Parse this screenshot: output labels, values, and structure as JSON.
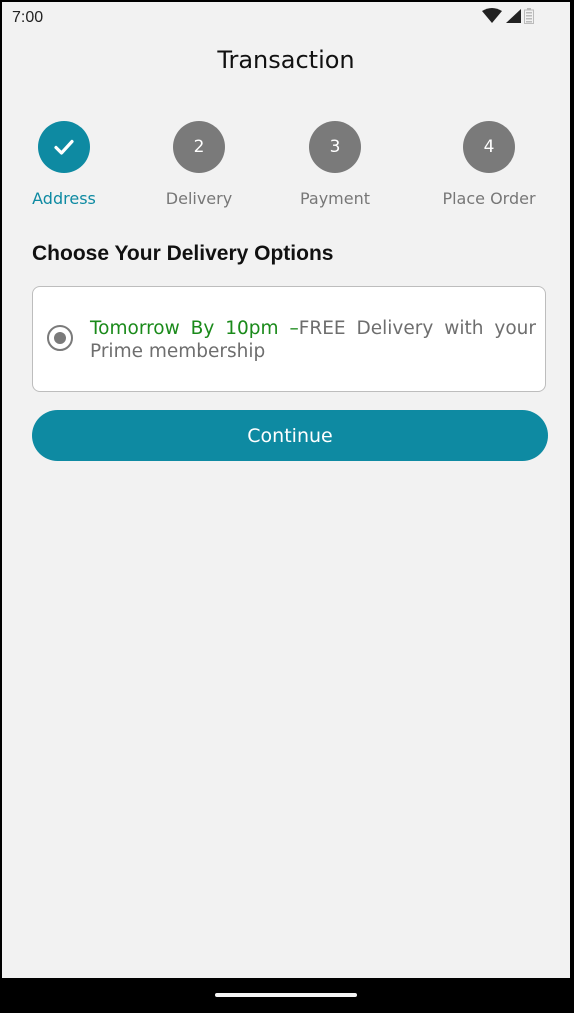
{
  "status_bar": {
    "time": "7:00",
    "icons": [
      "wifi-icon",
      "cellular-signal-icon",
      "battery-icon"
    ]
  },
  "header": {
    "title": "Transaction"
  },
  "stepper": {
    "steps": [
      {
        "number": "",
        "label": "Address",
        "state": "completed",
        "icon": "check-icon"
      },
      {
        "number": "2",
        "label": "Delivery",
        "state": "pending"
      },
      {
        "number": "3",
        "label": "Payment",
        "state": "pending"
      },
      {
        "number": "4",
        "label": "Place Order",
        "state": "pending"
      }
    ]
  },
  "delivery": {
    "heading": "Choose Your Delivery Options",
    "option": {
      "highlight": "Tomorrow By 10pm",
      "separator": " –",
      "description": "FREE Delivery with your Prime membership",
      "selected": true
    }
  },
  "actions": {
    "continue_label": "Continue"
  },
  "colors": {
    "accent": "#0e8aa2",
    "highlight_green": "#1a8a1a",
    "inactive_gray": "#7a7a7a",
    "background": "#f2f2f2"
  }
}
